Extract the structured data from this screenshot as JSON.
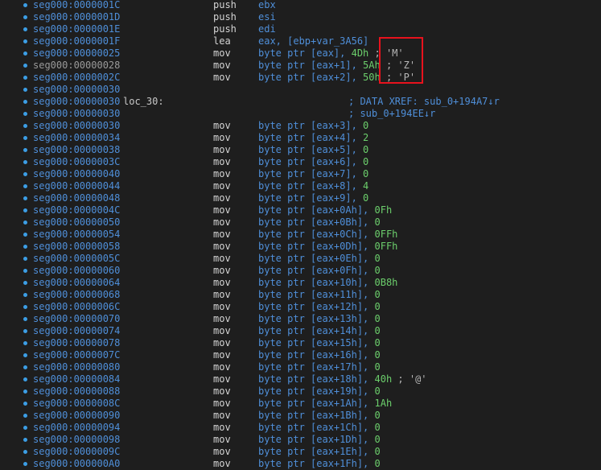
{
  "rows": [
    {
      "addr": "seg000:0000001C",
      "mn": "push",
      "ops": [
        {
          "t": "ebx",
          "c": "reg"
        }
      ]
    },
    {
      "addr": "seg000:0000001D",
      "mn": "push",
      "ops": [
        {
          "t": "esi",
          "c": "reg"
        }
      ]
    },
    {
      "addr": "seg000:0000001E",
      "mn": "push",
      "ops": [
        {
          "t": "edi",
          "c": "reg"
        }
      ]
    },
    {
      "addr": "seg000:0000001F",
      "mn": "lea",
      "ops": [
        {
          "t": "eax, [ebp+var_3A56]",
          "c": "reg"
        }
      ]
    },
    {
      "addr": "seg000:00000025",
      "mn": "mov",
      "ops": [
        {
          "t": "byte ptr [eax], ",
          "c": "reg"
        },
        {
          "t": "4Dh",
          "c": "num"
        },
        {
          "t": " ; 'M'",
          "c": "cmt"
        }
      ]
    },
    {
      "addr": "seg000:00000028",
      "mn": "mov",
      "cur": true,
      "ops": [
        {
          "t": "byte ptr [eax+1], ",
          "c": "reg"
        },
        {
          "t": "5Ah",
          "c": "num"
        },
        {
          "t": " ; 'Z'",
          "c": "cmt"
        }
      ]
    },
    {
      "addr": "seg000:0000002C",
      "mn": "mov",
      "ops": [
        {
          "t": "byte ptr [eax+2], ",
          "c": "reg"
        },
        {
          "t": "50h",
          "c": "num"
        },
        {
          "t": " ; 'P'",
          "c": "cmt"
        }
      ]
    },
    {
      "addr": "seg000:00000030",
      "mn": "",
      "ops": []
    },
    {
      "addr": "seg000:00000030",
      "label": "loc_30:",
      "mn": "",
      "ops": [],
      "xref": "; DATA XREF: sub_0+194A7↓r"
    },
    {
      "addr": "seg000:00000030",
      "mn": "",
      "ops": [],
      "xref": "; sub_0+194EE↓r"
    },
    {
      "addr": "seg000:00000030",
      "mn": "mov",
      "ops": [
        {
          "t": "byte ptr [eax+3], ",
          "c": "reg"
        },
        {
          "t": "0",
          "c": "num"
        }
      ]
    },
    {
      "addr": "seg000:00000034",
      "mn": "mov",
      "ops": [
        {
          "t": "byte ptr [eax+4], ",
          "c": "reg"
        },
        {
          "t": "2",
          "c": "num"
        }
      ]
    },
    {
      "addr": "seg000:00000038",
      "mn": "mov",
      "ops": [
        {
          "t": "byte ptr [eax+5], ",
          "c": "reg"
        },
        {
          "t": "0",
          "c": "num"
        }
      ]
    },
    {
      "addr": "seg000:0000003C",
      "mn": "mov",
      "ops": [
        {
          "t": "byte ptr [eax+6], ",
          "c": "reg"
        },
        {
          "t": "0",
          "c": "num"
        }
      ]
    },
    {
      "addr": "seg000:00000040",
      "mn": "mov",
      "ops": [
        {
          "t": "byte ptr [eax+7], ",
          "c": "reg"
        },
        {
          "t": "0",
          "c": "num"
        }
      ]
    },
    {
      "addr": "seg000:00000044",
      "mn": "mov",
      "ops": [
        {
          "t": "byte ptr [eax+8], ",
          "c": "reg"
        },
        {
          "t": "4",
          "c": "num"
        }
      ]
    },
    {
      "addr": "seg000:00000048",
      "mn": "mov",
      "ops": [
        {
          "t": "byte ptr [eax+9], ",
          "c": "reg"
        },
        {
          "t": "0",
          "c": "num"
        }
      ]
    },
    {
      "addr": "seg000:0000004C",
      "mn": "mov",
      "ops": [
        {
          "t": "byte ptr [eax+0Ah], ",
          "c": "reg"
        },
        {
          "t": "0Fh",
          "c": "num"
        }
      ]
    },
    {
      "addr": "seg000:00000050",
      "mn": "mov",
      "ops": [
        {
          "t": "byte ptr [eax+0Bh], ",
          "c": "reg"
        },
        {
          "t": "0",
          "c": "num"
        }
      ]
    },
    {
      "addr": "seg000:00000054",
      "mn": "mov",
      "ops": [
        {
          "t": "byte ptr [eax+0Ch], ",
          "c": "reg"
        },
        {
          "t": "0FFh",
          "c": "num"
        }
      ]
    },
    {
      "addr": "seg000:00000058",
      "mn": "mov",
      "ops": [
        {
          "t": "byte ptr [eax+0Dh], ",
          "c": "reg"
        },
        {
          "t": "0FFh",
          "c": "num"
        }
      ]
    },
    {
      "addr": "seg000:0000005C",
      "mn": "mov",
      "ops": [
        {
          "t": "byte ptr [eax+0Eh], ",
          "c": "reg"
        },
        {
          "t": "0",
          "c": "num"
        }
      ]
    },
    {
      "addr": "seg000:00000060",
      "mn": "mov",
      "ops": [
        {
          "t": "byte ptr [eax+0Fh], ",
          "c": "reg"
        },
        {
          "t": "0",
          "c": "num"
        }
      ]
    },
    {
      "addr": "seg000:00000064",
      "mn": "mov",
      "ops": [
        {
          "t": "byte ptr [eax+10h], ",
          "c": "reg"
        },
        {
          "t": "0B8h",
          "c": "num"
        }
      ]
    },
    {
      "addr": "seg000:00000068",
      "mn": "mov",
      "ops": [
        {
          "t": "byte ptr [eax+11h], ",
          "c": "reg"
        },
        {
          "t": "0",
          "c": "num"
        }
      ]
    },
    {
      "addr": "seg000:0000006C",
      "mn": "mov",
      "ops": [
        {
          "t": "byte ptr [eax+12h], ",
          "c": "reg"
        },
        {
          "t": "0",
          "c": "num"
        }
      ]
    },
    {
      "addr": "seg000:00000070",
      "mn": "mov",
      "ops": [
        {
          "t": "byte ptr [eax+13h], ",
          "c": "reg"
        },
        {
          "t": "0",
          "c": "num"
        }
      ]
    },
    {
      "addr": "seg000:00000074",
      "mn": "mov",
      "ops": [
        {
          "t": "byte ptr [eax+14h], ",
          "c": "reg"
        },
        {
          "t": "0",
          "c": "num"
        }
      ]
    },
    {
      "addr": "seg000:00000078",
      "mn": "mov",
      "ops": [
        {
          "t": "byte ptr [eax+15h], ",
          "c": "reg"
        },
        {
          "t": "0",
          "c": "num"
        }
      ]
    },
    {
      "addr": "seg000:0000007C",
      "mn": "mov",
      "ops": [
        {
          "t": "byte ptr [eax+16h], ",
          "c": "reg"
        },
        {
          "t": "0",
          "c": "num"
        }
      ]
    },
    {
      "addr": "seg000:00000080",
      "mn": "mov",
      "ops": [
        {
          "t": "byte ptr [eax+17h], ",
          "c": "reg"
        },
        {
          "t": "0",
          "c": "num"
        }
      ]
    },
    {
      "addr": "seg000:00000084",
      "mn": "mov",
      "ops": [
        {
          "t": "byte ptr [eax+18h], ",
          "c": "reg"
        },
        {
          "t": "40h",
          "c": "num"
        },
        {
          "t": " ; '@'",
          "c": "cmt"
        }
      ]
    },
    {
      "addr": "seg000:00000088",
      "mn": "mov",
      "ops": [
        {
          "t": "byte ptr [eax+19h], ",
          "c": "reg"
        },
        {
          "t": "0",
          "c": "num"
        }
      ]
    },
    {
      "addr": "seg000:0000008C",
      "mn": "mov",
      "ops": [
        {
          "t": "byte ptr [eax+1Ah], ",
          "c": "reg"
        },
        {
          "t": "1Ah",
          "c": "num"
        }
      ]
    },
    {
      "addr": "seg000:00000090",
      "mn": "mov",
      "ops": [
        {
          "t": "byte ptr [eax+1Bh], ",
          "c": "reg"
        },
        {
          "t": "0",
          "c": "num"
        }
      ]
    },
    {
      "addr": "seg000:00000094",
      "mn": "mov",
      "ops": [
        {
          "t": "byte ptr [eax+1Ch], ",
          "c": "reg"
        },
        {
          "t": "0",
          "c": "num"
        }
      ]
    },
    {
      "addr": "seg000:00000098",
      "mn": "mov",
      "ops": [
        {
          "t": "byte ptr [eax+1Dh], ",
          "c": "reg"
        },
        {
          "t": "0",
          "c": "num"
        }
      ]
    },
    {
      "addr": "seg000:0000009C",
      "mn": "mov",
      "ops": [
        {
          "t": "byte ptr [eax+1Eh], ",
          "c": "reg"
        },
        {
          "t": "0",
          "c": "num"
        }
      ]
    },
    {
      "addr": "seg000:000000A0",
      "mn": "mov",
      "ops": [
        {
          "t": "byte ptr [eax+1Fh], ",
          "c": "reg"
        },
        {
          "t": "0",
          "c": "num"
        }
      ]
    }
  ]
}
